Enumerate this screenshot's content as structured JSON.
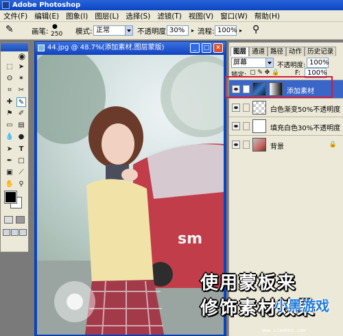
{
  "app": {
    "title": "Adobe Photoshop"
  },
  "menu": [
    "文件(F)",
    "编辑(E)",
    "图象(I)",
    "图层(L)",
    "选择(S)",
    "滤镜(T)",
    "视图(V)",
    "窗口(W)",
    "帮助(H)"
  ],
  "options": {
    "brush_label": "画笔:",
    "brush_size": "250",
    "mode_label": "模式:",
    "mode_value": "正常",
    "opacity_label": "不透明度:",
    "opacity_value": "30%",
    "flow_label": "流程:",
    "flow_value": "100%"
  },
  "document": {
    "title": "44.jpg @ 48.7%(添加素材,图层蒙版)"
  },
  "layers_panel": {
    "tabs": [
      "图层",
      "通道",
      "路径",
      "动作",
      "历史记录"
    ],
    "blend_mode": "屏幕",
    "opacity_label": "不透明度:",
    "opacity_value": "100%",
    "lock_label": "锁定:",
    "fill_label": "F:",
    "fill_value": "100%",
    "layers": [
      {
        "name": "添加素材",
        "selected": true
      },
      {
        "name": "白色渐变50%不透明度",
        "selected": false
      },
      {
        "name": "填充白色30%不透明度",
        "selected": false
      },
      {
        "name": "背景",
        "selected": false
      }
    ]
  },
  "overlay": {
    "line1": "使用蒙板来",
    "line2": "修饰素材效果",
    "brand": "小黑游戏",
    "site": "www.xiaohei.com"
  },
  "colors": {
    "accent": "#0a46c4",
    "selection": "#3a66c8",
    "highlight_box": "#d11a3a"
  }
}
